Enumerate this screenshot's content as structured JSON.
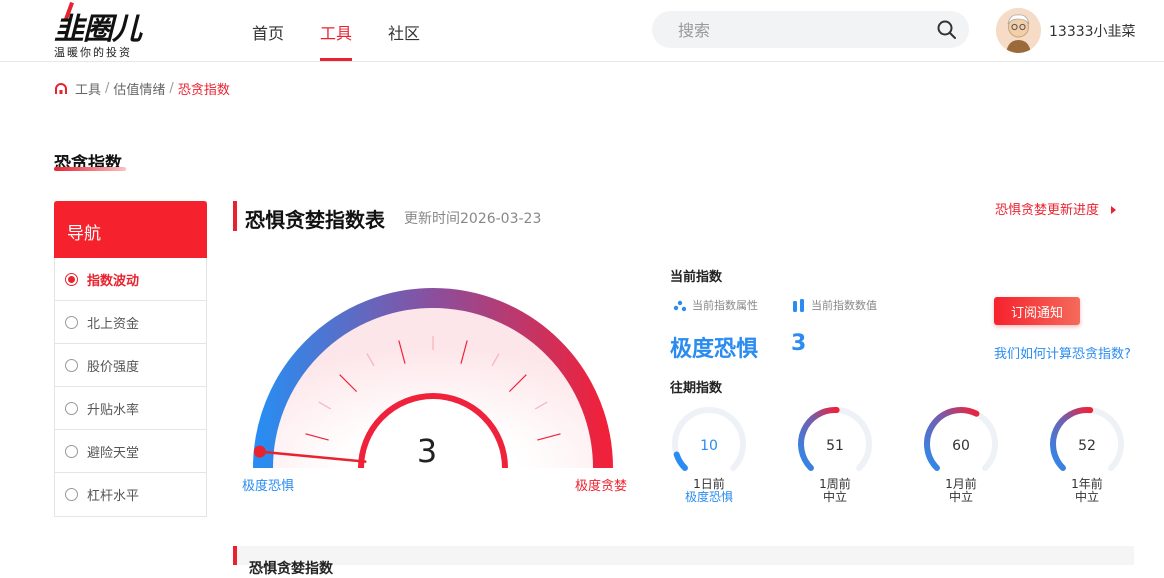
{
  "header": {
    "logo_text": "韭圈儿",
    "logo_slogan": "温暖你的投资",
    "nav": [
      {
        "label": "首页",
        "active": false
      },
      {
        "label": "工具",
        "active": true
      },
      {
        "label": "社区",
        "active": false
      }
    ],
    "search_placeholder": "搜索",
    "username": "13333小韭菜"
  },
  "breadcrumb": [
    "工具",
    "估值情绪",
    "恐贪指数"
  ],
  "page_title": "恐贪指数",
  "sidenav": {
    "title": "导航",
    "items": [
      {
        "label": "指数波动",
        "active": true
      },
      {
        "label": "北上资金",
        "active": false
      },
      {
        "label": "股价强度",
        "active": false
      },
      {
        "label": "升贴水率",
        "active": false
      },
      {
        "label": "避险天堂",
        "active": false
      },
      {
        "label": "杠杆水平",
        "active": false
      }
    ]
  },
  "main": {
    "title": "恐惧贪婪指数表",
    "update_time": "更新时间2026-03-23",
    "progress_link": "恐惧贪婪更新进度",
    "gauge": {
      "value": 3,
      "min": 0,
      "max": 100,
      "left_label": "极度恐惧",
      "right_label": "极度贪婪",
      "colors": {
        "blue": "#2a8cf0",
        "purple": "#8a4f9e",
        "red": "#f0213a"
      }
    },
    "current": {
      "section_label": "当前指数",
      "attr_label": "当前指数属性",
      "value_label": "当前指数数值",
      "attr": "极度恐惧",
      "value": "3"
    },
    "subscribe_label": "订阅通知",
    "how_link": "我们如何计算恐贪指数?",
    "past": {
      "section_label": "往期指数",
      "items": [
        {
          "value": 10,
          "value_text": "10",
          "period": "1日前",
          "state": "极度恐惧",
          "state_color": "#2a8cf0"
        },
        {
          "value": 51,
          "value_text": "51",
          "period": "1周前",
          "state": "中立",
          "state_color": "#333333"
        },
        {
          "value": 60,
          "value_text": "60",
          "period": "1月前",
          "state": "中立",
          "state_color": "#333333"
        },
        {
          "value": 52,
          "value_text": "52",
          "period": "1年前",
          "state": "中立",
          "state_color": "#333333"
        }
      ]
    },
    "bottom_title": "恐惧贪婪指数"
  }
}
